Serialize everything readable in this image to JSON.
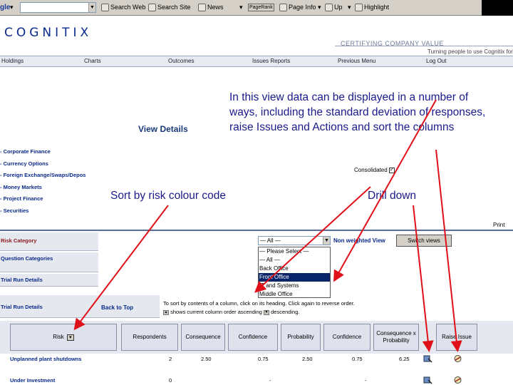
{
  "toolbar": {
    "address_value": "",
    "items": [
      "Search Web",
      "Search Site",
      "News",
      "PageRank",
      "Page Info",
      "Up",
      "Highlight"
    ]
  },
  "banner": {
    "logo": "COGNITIX",
    "tagline": "CERTIFYING COMPANY VALUE",
    "tagline2": "Turning people to use Cognitix  for"
  },
  "nav": [
    "Holdings",
    "Charts",
    "Outcomes",
    "Issues Reports",
    "Previous Menu",
    "Log Out"
  ],
  "view_title": "View Details",
  "categories": [
    "Corporate Finance",
    "Currency Options",
    "Foreign Exchange/Swaps/Depos",
    "Money Markets",
    "Project Finance",
    "Securities"
  ],
  "annotations": {
    "callout": "In this view data can be displayed in a number of ways, including the standard deviation of responses, raise Issues and Actions and sort the columns",
    "sort": "Sort by risk colour code",
    "drill": "Drill down"
  },
  "consolidated": {
    "label": "Consolidated",
    "checked": true
  },
  "print": "Print",
  "risk_category_label": "Risk Category",
  "left_rows": [
    "Question Categories",
    "Trial Run Details",
    "Trial Run Details"
  ],
  "filter": {
    "selected": "— All —",
    "options": [
      "— Please Select —",
      "— All —",
      "Back Office",
      "Front Office",
      "IT and Systems",
      "Middle Office"
    ],
    "highlighted": "Front Office"
  },
  "non_weighted_label": "Non weighted View",
  "switch_views_label": "Switch views",
  "back_to_top": "Back to Top",
  "sort_hint": [
    "To sort by contents of a column, click on its heading. Click again to reverse order.",
    "shows current column order ascending",
    "descending."
  ],
  "table": {
    "headers": [
      "Risk",
      "Respondents",
      "Consequence",
      "Confidence",
      "Probability",
      "Confidence",
      "Consequence x Probability",
      "Raise Issue"
    ],
    "rows": [
      {
        "name": "Unplanned plant shutdowns",
        "respondents": "2",
        "consequence": "2.50",
        "confidence1": "0.75",
        "probability": "2.50",
        "confidence2": "0.75",
        "cxp": "6.25"
      },
      {
        "name": "Under Investment",
        "respondents": "0",
        "consequence": "-",
        "confidence1": "",
        "probability": "-",
        "confidence2": "",
        "cxp": ""
      }
    ]
  },
  "colors": {
    "annotation": "#1a1a8a",
    "arrow": "#e0101a",
    "nav_link": "#0a2a8a"
  }
}
